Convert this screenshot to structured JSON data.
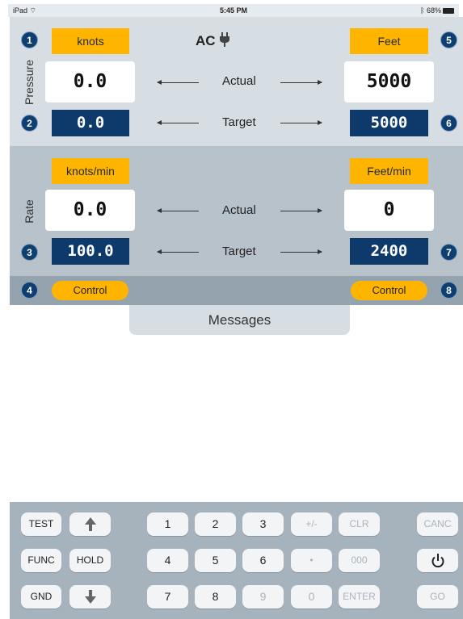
{
  "status_bar": {
    "device": "iPad",
    "wifi_icon": "wifi-icon",
    "time": "5:45 PM",
    "bluetooth_icon": "bluetooth-icon",
    "battery": "68%"
  },
  "pressure": {
    "side_label": "Pressure",
    "unit_left": "knots",
    "unit_right": "Feet",
    "power_source": "AC",
    "power_icon": "plug-icon",
    "actual_left": "0.0",
    "actual_right": "5000",
    "actual_label": "Actual",
    "target_left": "0.0",
    "target_right": "5000",
    "target_label": "Target",
    "markers": [
      "1",
      "2",
      "5",
      "6"
    ]
  },
  "rate": {
    "side_label": "Rate",
    "unit_left": "knots/min",
    "unit_right": "Feet/min",
    "actual_left": "0.0",
    "actual_right": "0",
    "actual_label": "Actual",
    "target_left": "100.0",
    "target_right": "2400",
    "target_label": "Target",
    "markers": [
      "3",
      "7"
    ]
  },
  "control": {
    "left_label": "Control",
    "right_label": "Control",
    "markers": [
      "4",
      "8"
    ]
  },
  "messages": {
    "tab_label": "Messages"
  },
  "keypad": {
    "test": "TEST",
    "func": "FUNC",
    "gnd": "GND",
    "hold": "HOLD",
    "up_icon": "arrow-up-icon",
    "down_icon": "arrow-down-icon",
    "digits": [
      "1",
      "2",
      "3",
      "4",
      "5",
      "6",
      "7",
      "8",
      "9",
      "0"
    ],
    "plus_minus": "+/-",
    "dot": "•",
    "clr": "CLR",
    "zeros": "000",
    "enter": "ENTER",
    "canc": "CANC",
    "power_icon": "power-icon",
    "go": "GO"
  },
  "colors": {
    "accent": "#ffb400",
    "navy": "#0e3a6b",
    "panel_light": "#d6dde3",
    "panel_mid": "#b7c2cb",
    "panel_dark": "#94a3ae",
    "keypad_bg": "#a6b2bc"
  }
}
